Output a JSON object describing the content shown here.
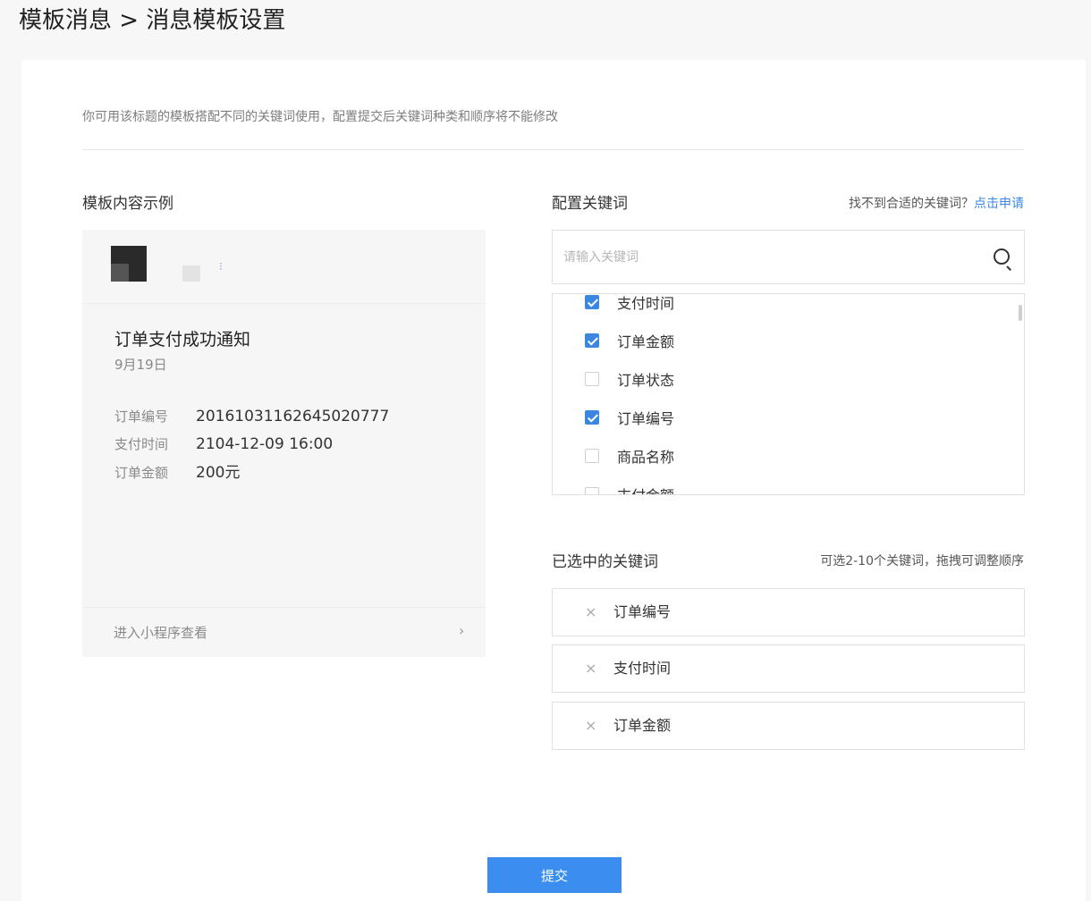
{
  "page": {
    "breadcrumb": "模板消息 > 消息模板设置"
  },
  "notice": "你可用该标题的模板搭配不同的关键词使用，配置提交后关键词种类和顺序将不能修改",
  "preview": {
    "section_title": "模板内容示例",
    "menu_glyph": "⁝",
    "title": "订单支付成功通知",
    "date": "9月19日",
    "rows": [
      {
        "key": "订单编号",
        "value": "20161031162645020777"
      },
      {
        "key": "支付时间",
        "value": "2104-12-09 16:00"
      },
      {
        "key": "订单金额",
        "value": "200元"
      }
    ],
    "footer_link": "进入小程序查看",
    "chevron": "›"
  },
  "keywords": {
    "section_title": "配置关键词",
    "hint_text": "找不到合适的关键词？",
    "hint_link": "点击申请",
    "search_placeholder": "请输入关键词",
    "items": [
      {
        "label": "支付时间",
        "checked": true
      },
      {
        "label": "订单金额",
        "checked": true
      },
      {
        "label": "订单状态",
        "checked": false
      },
      {
        "label": "订单编号",
        "checked": true
      },
      {
        "label": "商品名称",
        "checked": false
      },
      {
        "label": "支付金额",
        "checked": false
      }
    ]
  },
  "selected": {
    "section_title": "已选中的关键词",
    "hint": "可选2-10个关键词，拖拽可调整顺序",
    "remove_glyph": "×",
    "items": [
      "订单编号",
      "支付时间",
      "订单金额"
    ]
  },
  "submit_label": "提交"
}
